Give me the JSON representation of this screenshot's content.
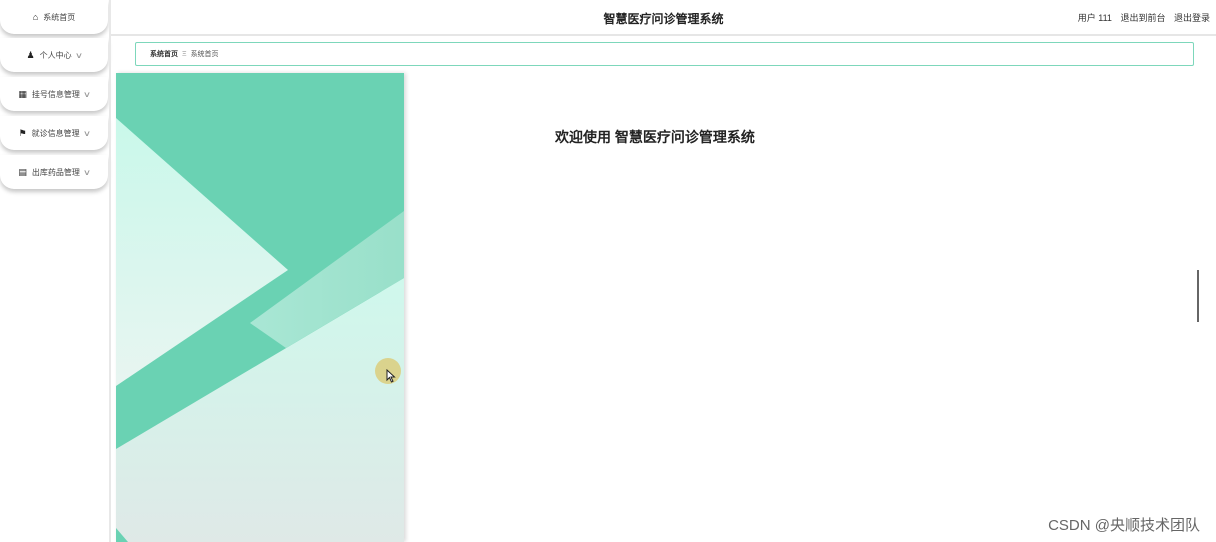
{
  "sidebar": {
    "items": [
      {
        "label": "系统首页",
        "icon": "home-icon",
        "glyph": "⌂",
        "has_chevron": false
      },
      {
        "label": "个人中心",
        "icon": "user-icon",
        "glyph": "♟",
        "has_chevron": true
      },
      {
        "label": "挂号信息管理",
        "icon": "grid-icon",
        "glyph": "▦",
        "has_chevron": true
      },
      {
        "label": "就诊信息管理",
        "icon": "flag-icon",
        "glyph": "⚑",
        "has_chevron": true
      },
      {
        "label": "出库药品管理",
        "icon": "clipboard-icon",
        "glyph": "▤",
        "has_chevron": true
      }
    ],
    "chevron_glyph": "∨"
  },
  "header": {
    "title": "智慧医疗问诊管理系统",
    "user": "用户 111",
    "to_front": "退出到前台",
    "logout": "退出登录"
  },
  "breadcrumb": {
    "first": "系统首页",
    "separator": "Ξ",
    "current": "系统首页"
  },
  "main": {
    "welcome": "欢迎使用 智慧医疗问诊管理系统"
  },
  "watermark": "CSDN @央顺技术团队",
  "colors": {
    "accent": "#6ad2b3",
    "accent_light": "#c8f7ea",
    "border": "#7dd7bb"
  }
}
